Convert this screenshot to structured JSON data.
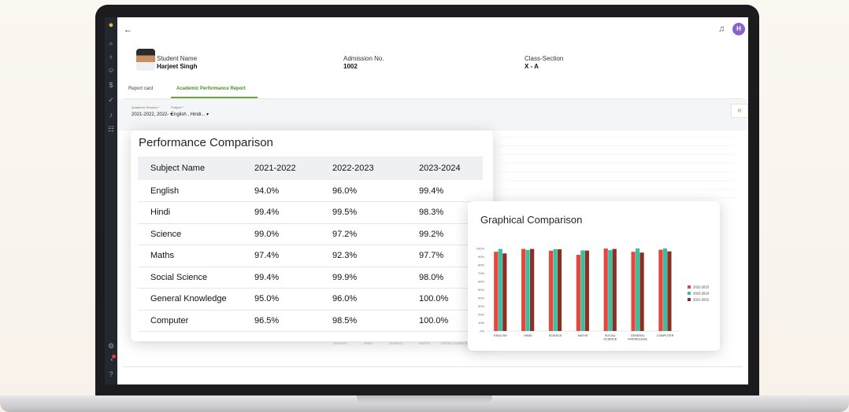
{
  "sidebar": {
    "icons": [
      "bulb-icon",
      "search-icon",
      "medal-icon",
      "users-icon",
      "dollar-icon",
      "thumbs-up-icon",
      "bell-icon",
      "group-icon"
    ],
    "bottom_icons": [
      "settings-icon",
      "notification-icon",
      "help-icon"
    ]
  },
  "topbar": {
    "avatar_initial": "H"
  },
  "student": {
    "name_label": "Student Name",
    "name": "Harjeet Singh",
    "admission_label": "Admission No.",
    "admission_no": "1002",
    "class_label": "Class-Section",
    "class_section": "X - A"
  },
  "tabs": [
    {
      "label": "Report card"
    },
    {
      "label": "Academic Performance Report"
    }
  ],
  "filters": {
    "session_label": "Academic Session *",
    "session_value": "2021-2022, 2022-",
    "subject_label": "Subject *",
    "subject_value": "English , Hindi..."
  },
  "background_axis": [
    "ENGLISH",
    "HINDI",
    "SCIENCE",
    "MATHS",
    "SOCIAL SCIENCE"
  ],
  "performance": {
    "title": "Performance Comparison",
    "headers": [
      "Subject Name",
      "2021-2022",
      "2022-2023",
      "2023-2024"
    ],
    "rows": [
      [
        "English",
        "94.0%",
        "96.0%",
        "99.4%"
      ],
      [
        "Hindi",
        "99.4%",
        "99.5%",
        "98.3%"
      ],
      [
        "Science",
        "99.0%",
        "97.2%",
        "99.2%"
      ],
      [
        "Maths",
        "97.4%",
        "92.3%",
        "97.7%"
      ],
      [
        "Social Science",
        "99.4%",
        "99.9%",
        "98.0%"
      ],
      [
        "General Knowledge",
        "95.0%",
        "96.0%",
        "100.0%"
      ],
      [
        "Computer",
        "96.5%",
        "98.5%",
        "100.0%"
      ]
    ]
  },
  "graph": {
    "title": "Graphical Comparison",
    "colors": {
      "2022-2023": "#e8453c",
      "2023-2024": "#3bbfa0",
      "2021-2022": "#8b2e23"
    }
  },
  "chart_data": {
    "type": "bar",
    "categories": [
      "ENGLISH",
      "HINDI",
      "SCIENCE",
      "MATHS",
      "SOCIAL SCIENCE",
      "GENERAL KNOWLEDGE",
      "COMPUTER"
    ],
    "series": [
      {
        "name": "2022-2023",
        "values": [
          96.0,
          99.5,
          97.2,
          92.3,
          99.9,
          96.0,
          98.5
        ]
      },
      {
        "name": "2023-2024",
        "values": [
          99.4,
          98.3,
          99.2,
          97.7,
          98.0,
          100.0,
          100.0
        ]
      },
      {
        "name": "2021-2022",
        "values": [
          94.0,
          99.4,
          99.0,
          97.4,
          99.4,
          95.0,
          96.5
        ]
      }
    ],
    "ylim": [
      0,
      100
    ],
    "yticks": [
      "0%",
      "10%",
      "20%",
      "30%",
      "40%",
      "50%",
      "60%",
      "70%",
      "80%",
      "90%",
      "100%"
    ],
    "legend_position": "right"
  }
}
